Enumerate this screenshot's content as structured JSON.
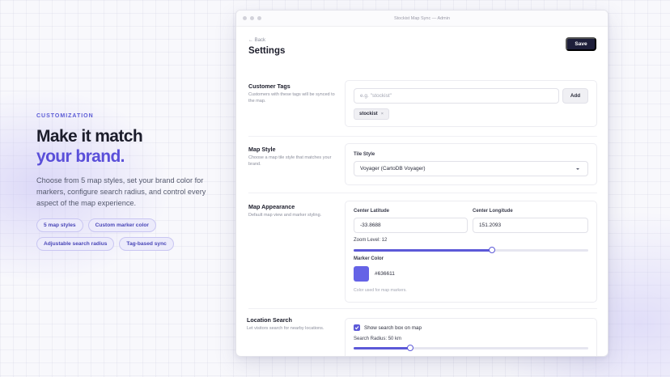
{
  "hero": {
    "eyebrow": "CUSTOMIZATION",
    "headline_line1": "Make it match",
    "headline_line2": "your brand.",
    "lead": "Choose from 5 map styles, set your brand color for markers, configure search radius, and control every aspect of the map experience.",
    "pills": [
      "5 map styles",
      "Custom marker color",
      "Adjustable search radius",
      "Tag-based sync"
    ]
  },
  "window": {
    "title": "Stockist Map Sync — Admin",
    "back_label": "← Back",
    "page_title": "Settings",
    "save_label": "Save"
  },
  "sections": {
    "customer_tags": {
      "label": "Customer Tags",
      "description": "Customers with these tags will be synced to the map.",
      "input_placeholder": "e.g. \"stockist\"",
      "add_label": "Add",
      "tags": [
        "stockist"
      ],
      "remove_glyph": "×"
    },
    "map_style": {
      "label": "Map Style",
      "description": "Choose a map tile style that matches your brand.",
      "field_label": "Tile Style",
      "selected": "Voyager (CartoDB Voyager)"
    },
    "map_appearance": {
      "label": "Map Appearance",
      "description": "Default map view and marker styling.",
      "lat_label": "Center Latitude",
      "lat_value": "-33.8688",
      "lng_label": "Center Longitude",
      "lng_value": "151.2093",
      "zoom_label": "Zoom Level: 12",
      "zoom_fraction": 0.59,
      "marker_label": "Marker Color",
      "marker_hex": "#636611",
      "marker_swatch_color": "#6563e6",
      "marker_hint": "Color used for map markers."
    },
    "location_search": {
      "label": "Location Search",
      "description": "Let visitors search for nearby locations.",
      "checkbox_label": "Show search box on map",
      "checked": true,
      "radius_label": "Search Radius: 50 km",
      "radius_fraction": 0.24
    }
  }
}
